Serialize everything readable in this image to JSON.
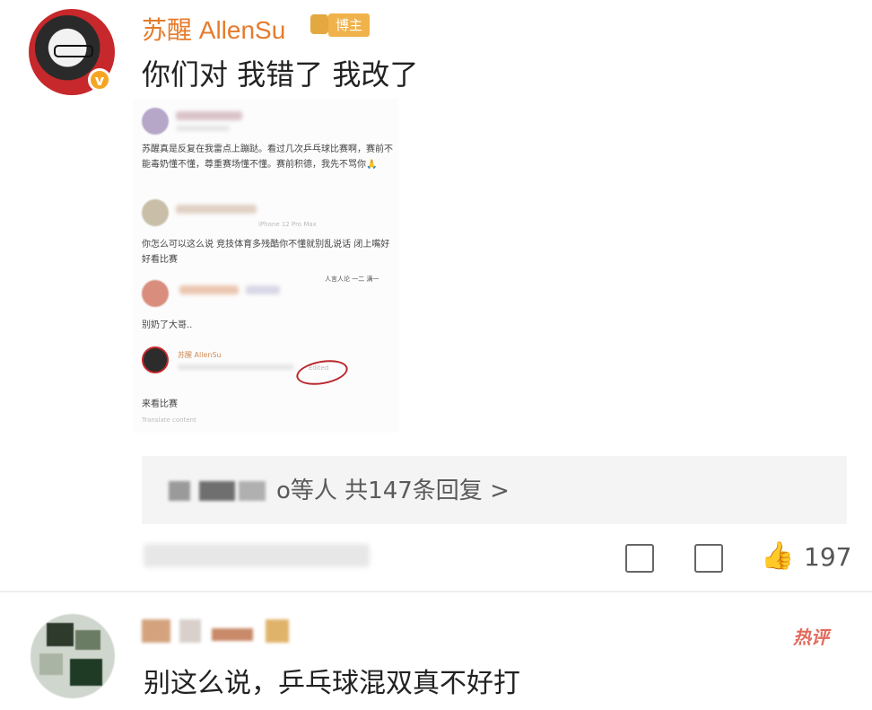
{
  "main_comment": {
    "username": "苏醒 AllenSu",
    "verified_mark": "v",
    "creator_badge": "博主",
    "text": "你们对 我错了 我改了"
  },
  "embedded_screenshot": {
    "first_comment_text": "苏醒真是反复在我雷点上蹦跶。看过几次乒乓球比赛啊，赛前不能毒奶懂不懂，尊重赛场懂不懂。赛前积德，我先不骂你🙏",
    "second_comment_text": "你怎么可以这么说 竞技体育多残酷你不懂就别乱说话 闭上嘴好好看比赛",
    "third_comment_text": "别奶了大哥..",
    "sticker_text": "人言人论 一二 满一",
    "second_meta": "iPhone 12 Pro Max",
    "author_name": "苏醒 AllenSu",
    "edited_label": "Edited",
    "author_reply_text": "来看比赛",
    "translate_link": "Translate content"
  },
  "reply_summary": {
    "text": "o等人  共147条回复 >"
  },
  "actions": {
    "like_count": "197"
  },
  "second_comment": {
    "hot_badge": "热评",
    "text": "别这么说，乒乓球混双真不好打"
  }
}
